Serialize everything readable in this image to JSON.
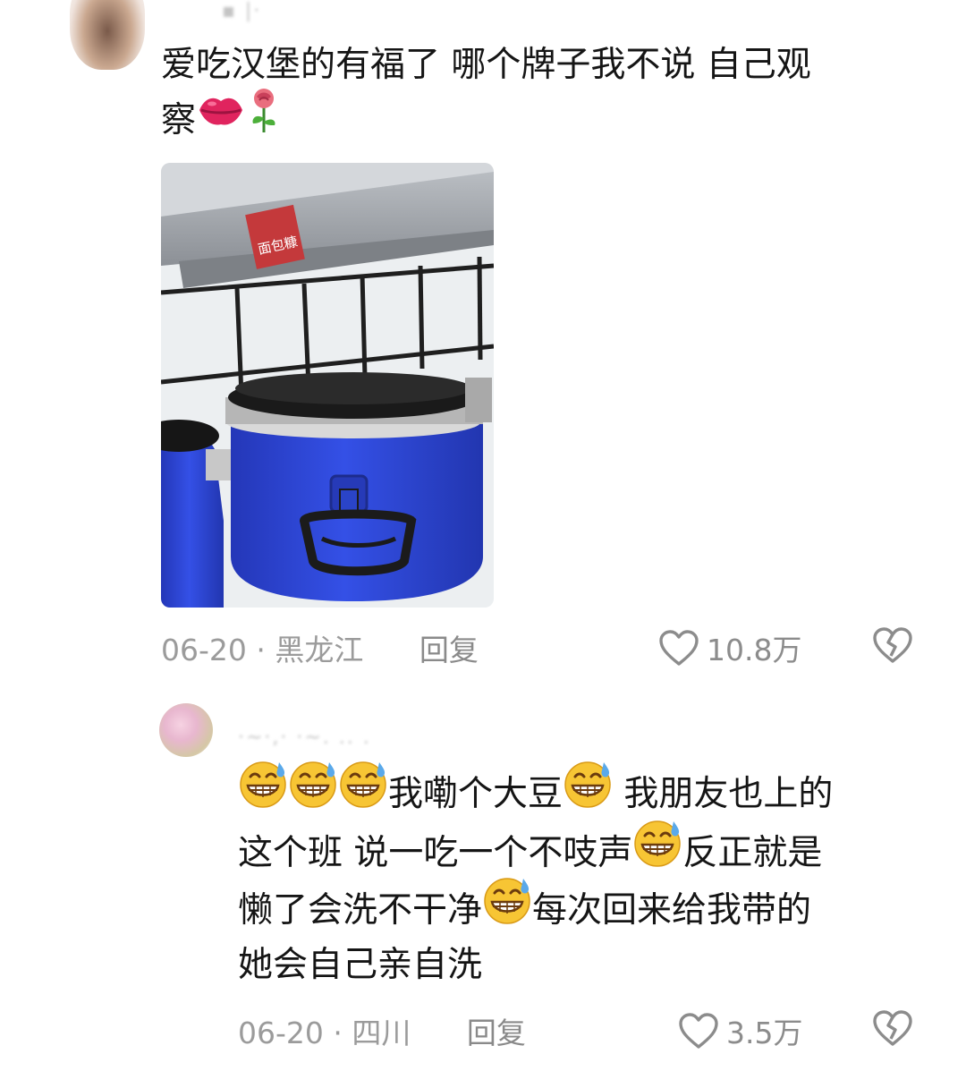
{
  "comments": [
    {
      "username": "▪ |·",
      "text_line1": "爱吃汉堡的有福了 哪个牌子我不说 自己观",
      "text_line2": "察",
      "emojis_line2": [
        "kiss-lips-icon",
        "rose-icon"
      ],
      "photo_label": "面包糠",
      "date": "06-20",
      "sep": "·",
      "location": "黑龙江",
      "reply_label": "回复",
      "likes": "10.8万"
    },
    {
      "username": "·~·,· ·~. .. .",
      "line1_text_a": "我嘞个大豆",
      "line1_text_b": " 我朋友也上的",
      "line2_text_a": "这个班 说一吃一个不吱声",
      "line2_text_b": "反正就是",
      "line3_text_a": "懒了会洗不干净",
      "line3_text_b": "每次回来给我带的",
      "line4_text": "她会自己亲自洗",
      "date": "06-20",
      "sep": "·",
      "location": "四川",
      "reply_label": "回复",
      "likes": "3.5万"
    }
  ],
  "colors": {
    "meta_gray": "#9b9b9b",
    "barrel_blue": "#2f45d6",
    "emoji_yellow": "#f7c534"
  }
}
